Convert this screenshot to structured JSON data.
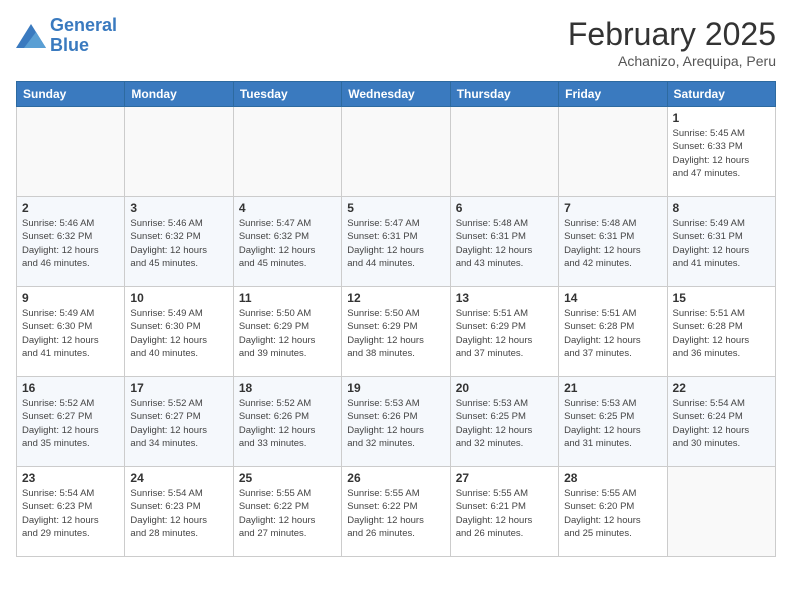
{
  "header": {
    "logo_line1": "General",
    "logo_line2": "Blue",
    "month": "February 2025",
    "location": "Achanizo, Arequipa, Peru"
  },
  "weekdays": [
    "Sunday",
    "Monday",
    "Tuesday",
    "Wednesday",
    "Thursday",
    "Friday",
    "Saturday"
  ],
  "weeks": [
    [
      {
        "day": "",
        "info": ""
      },
      {
        "day": "",
        "info": ""
      },
      {
        "day": "",
        "info": ""
      },
      {
        "day": "",
        "info": ""
      },
      {
        "day": "",
        "info": ""
      },
      {
        "day": "",
        "info": ""
      },
      {
        "day": "1",
        "info": "Sunrise: 5:45 AM\nSunset: 6:33 PM\nDaylight: 12 hours\nand 47 minutes."
      }
    ],
    [
      {
        "day": "2",
        "info": "Sunrise: 5:46 AM\nSunset: 6:32 PM\nDaylight: 12 hours\nand 46 minutes."
      },
      {
        "day": "3",
        "info": "Sunrise: 5:46 AM\nSunset: 6:32 PM\nDaylight: 12 hours\nand 45 minutes."
      },
      {
        "day": "4",
        "info": "Sunrise: 5:47 AM\nSunset: 6:32 PM\nDaylight: 12 hours\nand 45 minutes."
      },
      {
        "day": "5",
        "info": "Sunrise: 5:47 AM\nSunset: 6:31 PM\nDaylight: 12 hours\nand 44 minutes."
      },
      {
        "day": "6",
        "info": "Sunrise: 5:48 AM\nSunset: 6:31 PM\nDaylight: 12 hours\nand 43 minutes."
      },
      {
        "day": "7",
        "info": "Sunrise: 5:48 AM\nSunset: 6:31 PM\nDaylight: 12 hours\nand 42 minutes."
      },
      {
        "day": "8",
        "info": "Sunrise: 5:49 AM\nSunset: 6:31 PM\nDaylight: 12 hours\nand 41 minutes."
      }
    ],
    [
      {
        "day": "9",
        "info": "Sunrise: 5:49 AM\nSunset: 6:30 PM\nDaylight: 12 hours\nand 41 minutes."
      },
      {
        "day": "10",
        "info": "Sunrise: 5:49 AM\nSunset: 6:30 PM\nDaylight: 12 hours\nand 40 minutes."
      },
      {
        "day": "11",
        "info": "Sunrise: 5:50 AM\nSunset: 6:29 PM\nDaylight: 12 hours\nand 39 minutes."
      },
      {
        "day": "12",
        "info": "Sunrise: 5:50 AM\nSunset: 6:29 PM\nDaylight: 12 hours\nand 38 minutes."
      },
      {
        "day": "13",
        "info": "Sunrise: 5:51 AM\nSunset: 6:29 PM\nDaylight: 12 hours\nand 37 minutes."
      },
      {
        "day": "14",
        "info": "Sunrise: 5:51 AM\nSunset: 6:28 PM\nDaylight: 12 hours\nand 37 minutes."
      },
      {
        "day": "15",
        "info": "Sunrise: 5:51 AM\nSunset: 6:28 PM\nDaylight: 12 hours\nand 36 minutes."
      }
    ],
    [
      {
        "day": "16",
        "info": "Sunrise: 5:52 AM\nSunset: 6:27 PM\nDaylight: 12 hours\nand 35 minutes."
      },
      {
        "day": "17",
        "info": "Sunrise: 5:52 AM\nSunset: 6:27 PM\nDaylight: 12 hours\nand 34 minutes."
      },
      {
        "day": "18",
        "info": "Sunrise: 5:52 AM\nSunset: 6:26 PM\nDaylight: 12 hours\nand 33 minutes."
      },
      {
        "day": "19",
        "info": "Sunrise: 5:53 AM\nSunset: 6:26 PM\nDaylight: 12 hours\nand 32 minutes."
      },
      {
        "day": "20",
        "info": "Sunrise: 5:53 AM\nSunset: 6:25 PM\nDaylight: 12 hours\nand 32 minutes."
      },
      {
        "day": "21",
        "info": "Sunrise: 5:53 AM\nSunset: 6:25 PM\nDaylight: 12 hours\nand 31 minutes."
      },
      {
        "day": "22",
        "info": "Sunrise: 5:54 AM\nSunset: 6:24 PM\nDaylight: 12 hours\nand 30 minutes."
      }
    ],
    [
      {
        "day": "23",
        "info": "Sunrise: 5:54 AM\nSunset: 6:23 PM\nDaylight: 12 hours\nand 29 minutes."
      },
      {
        "day": "24",
        "info": "Sunrise: 5:54 AM\nSunset: 6:23 PM\nDaylight: 12 hours\nand 28 minutes."
      },
      {
        "day": "25",
        "info": "Sunrise: 5:55 AM\nSunset: 6:22 PM\nDaylight: 12 hours\nand 27 minutes."
      },
      {
        "day": "26",
        "info": "Sunrise: 5:55 AM\nSunset: 6:22 PM\nDaylight: 12 hours\nand 26 minutes."
      },
      {
        "day": "27",
        "info": "Sunrise: 5:55 AM\nSunset: 6:21 PM\nDaylight: 12 hours\nand 26 minutes."
      },
      {
        "day": "28",
        "info": "Sunrise: 5:55 AM\nSunset: 6:20 PM\nDaylight: 12 hours\nand 25 minutes."
      },
      {
        "day": "",
        "info": ""
      }
    ]
  ]
}
